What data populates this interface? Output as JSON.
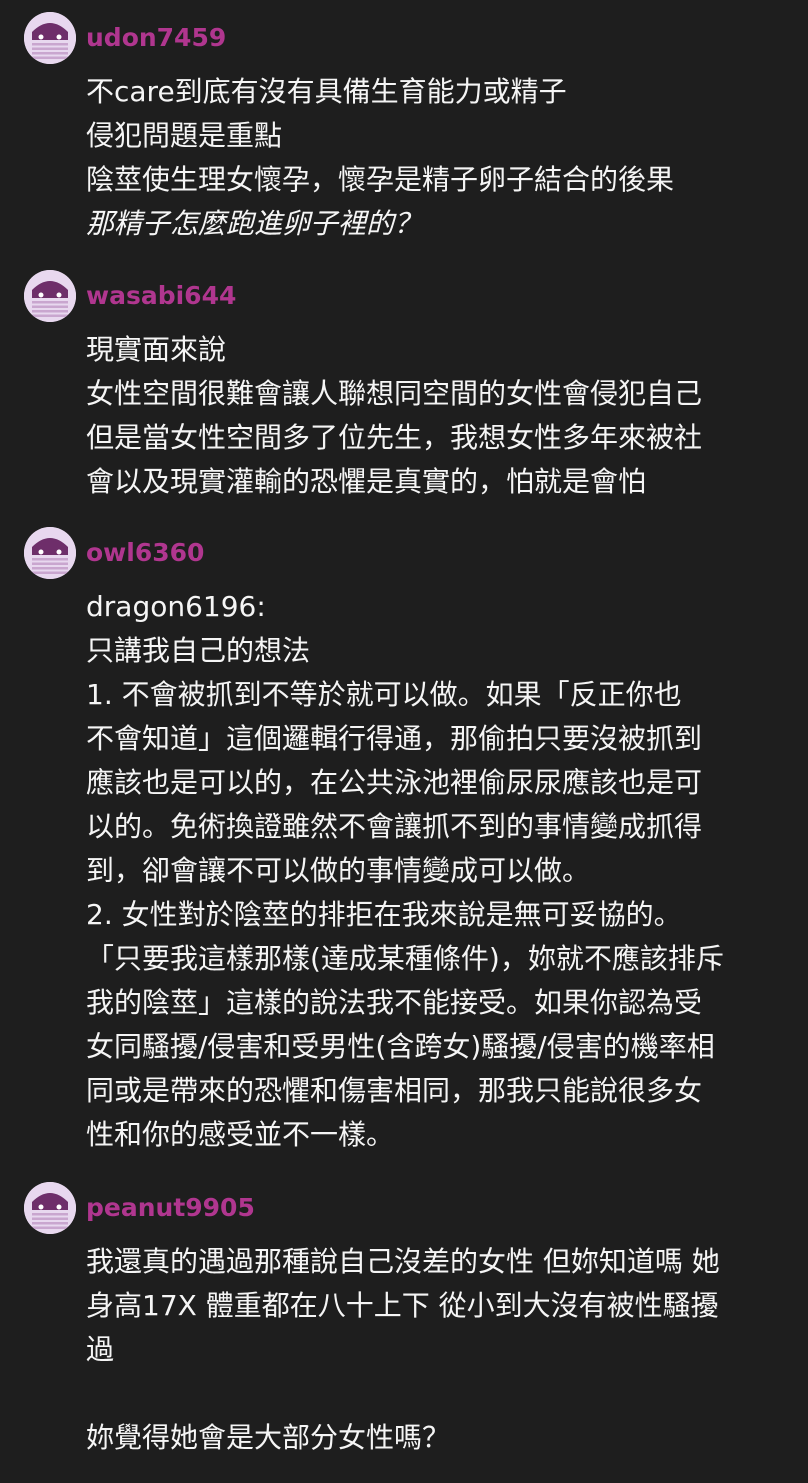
{
  "comments": [
    {
      "username": "udon7459",
      "lines": [
        {
          "text": "不care到底有沒有具備生育能力或精子"
        },
        {
          "text": "侵犯問題是重點"
        },
        {
          "text": "陰莖使生理女懷孕，懷孕是精子卵子結合的後果"
        },
        {
          "text": "那精子怎麼跑進卵子裡的？",
          "italic": true
        }
      ]
    },
    {
      "username": "wasabi644",
      "lines": [
        {
          "text": "現實面來說"
        },
        {
          "text": "女性空間很難會讓人聯想同空間的女性會侵犯自己"
        },
        {
          "text": "但是當女性空間多了位先生，我想女性多年來被社"
        },
        {
          "text": "會以及現實灌輸的恐懼是真實的，怕就是會怕"
        }
      ]
    },
    {
      "username": "owl6360",
      "lines": [
        {
          "text": "dragon6196:"
        },
        {
          "text": "只講我自己的想法"
        },
        {
          "text": "1. 不會被抓到不等於就可以做。如果「反正你也"
        },
        {
          "text": "不會知道」這個邏輯行得通，那偷拍只要沒被抓到"
        },
        {
          "text": "應該也是可以的，在公共泳池裡偷尿尿應該也是可"
        },
        {
          "text": "以的。免術換證雖然不會讓抓不到的事情變成抓得"
        },
        {
          "text": "到，卻會讓不可以做的事情變成可以做。"
        },
        {
          "text": "2. 女性對於陰莖的排拒在我來說是無可妥協的。"
        },
        {
          "text": "「只要我這樣那樣(達成某種條件)，妳就不應該排斥"
        },
        {
          "text": "我的陰莖」這樣的說法我不能接受。如果你認為受"
        },
        {
          "text": "女同騷擾/侵害和受男性(含跨女)騷擾/侵害的機率相"
        },
        {
          "text": "同或是帶來的恐懼和傷害相同，那我只能說很多女"
        },
        {
          "text": "性和你的感受並不一樣。"
        }
      ]
    },
    {
      "username": "peanut9905",
      "lines": [
        {
          "text": "我還真的遇過那種說自己沒差的女性 但妳知道嗎 她"
        },
        {
          "text": "身高17X 體重都在八十上下 從小到大沒有被性騷擾"
        },
        {
          "text": "過"
        },
        {
          "text": ""
        },
        {
          "text": "妳覺得她會是大部分女性嗎？"
        }
      ]
    }
  ],
  "theme": {
    "background": "#1e1e1e",
    "username_color": "#b0368f",
    "text_color": "#f5f5f5",
    "avatar_bg": "#e8d8ef",
    "avatar_stripe": "#c9a6cf",
    "avatar_accent": "#6e2e6a"
  },
  "avatar_icon": "masked-face-icon"
}
